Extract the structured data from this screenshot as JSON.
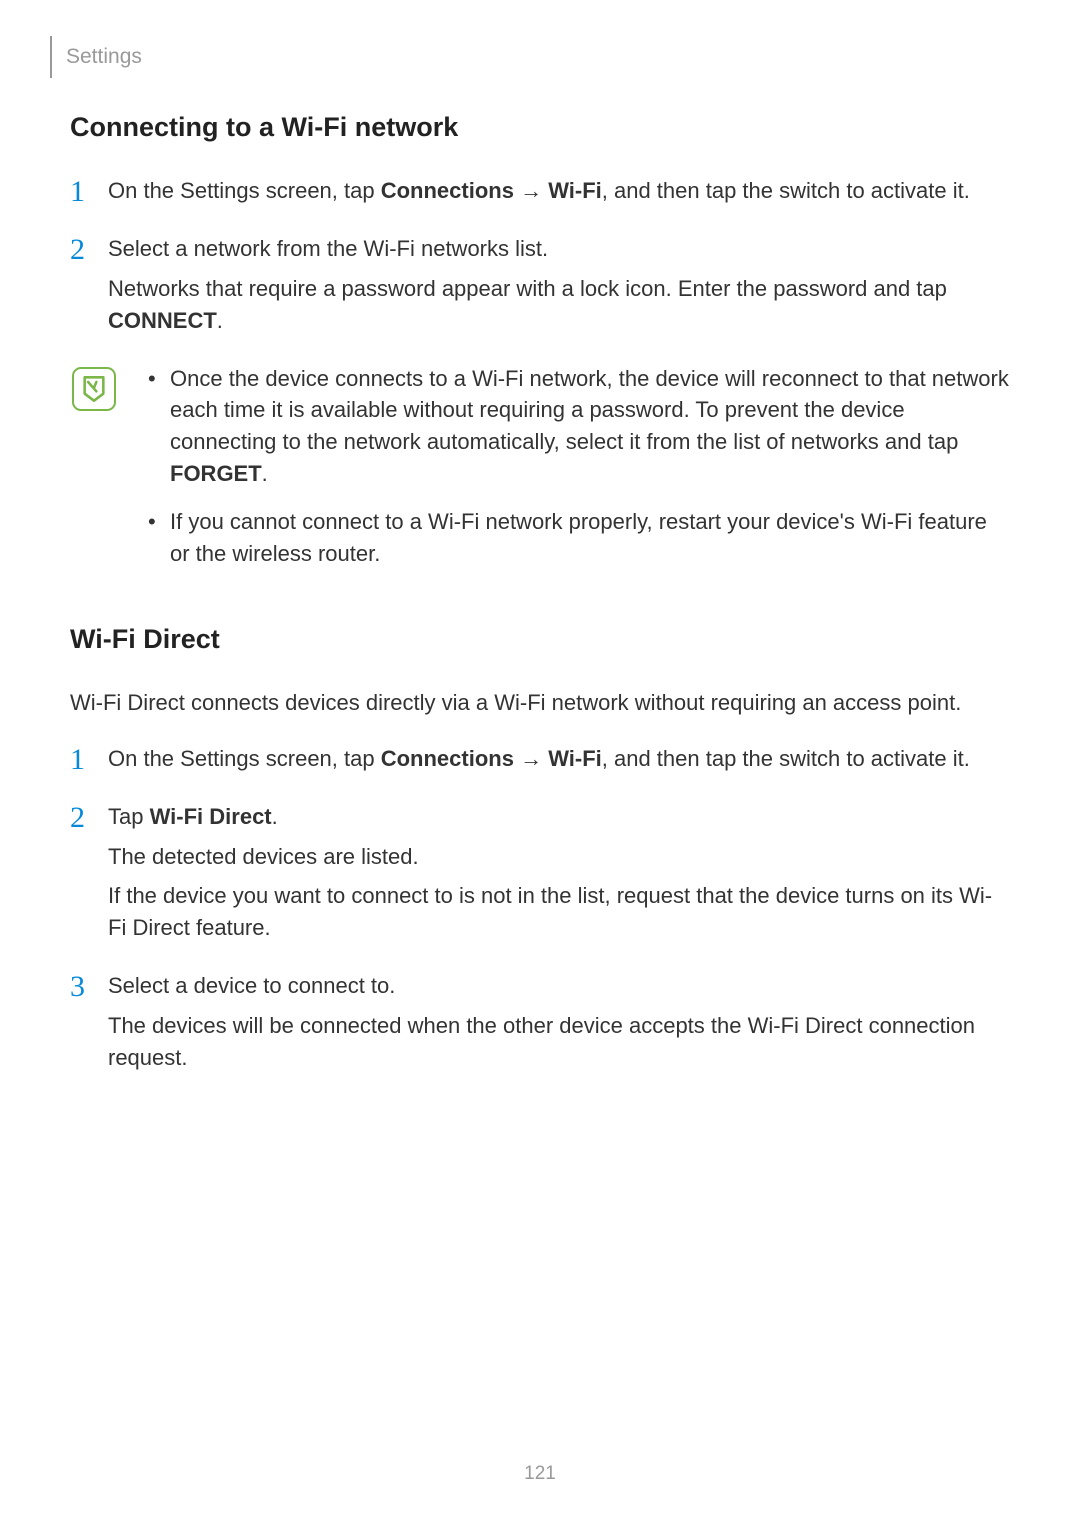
{
  "header": {
    "breadcrumb": "Settings"
  },
  "section1": {
    "title": "Connecting to a Wi-Fi network",
    "step1": {
      "num": "1",
      "pre": "On the Settings screen, tap ",
      "bold1": "Connections",
      "arrow": " → ",
      "bold2": "Wi-Fi",
      "post": ", and then tap the switch to activate it."
    },
    "step2": {
      "num": "2",
      "line1": "Select a network from the Wi-Fi networks list.",
      "line2pre": "Networks that require a password appear with a lock icon. Enter the password and tap ",
      "line2bold": "CONNECT",
      "line2post": "."
    },
    "note": {
      "bullet1pre": "Once the device connects to a Wi-Fi network, the device will reconnect to that network each time it is available without requiring a password. To prevent the device connecting to the network automatically, select it from the list of networks and tap ",
      "bullet1bold": "FORGET",
      "bullet1post": ".",
      "bullet2": "If you cannot connect to a Wi-Fi network properly, restart your device's Wi-Fi feature or the wireless router."
    }
  },
  "section2": {
    "title": "Wi-Fi Direct",
    "intro": "Wi-Fi Direct connects devices directly via a Wi-Fi network without requiring an access point.",
    "step1": {
      "num": "1",
      "pre": "On the Settings screen, tap ",
      "bold1": "Connections",
      "arrow": " → ",
      "bold2": "Wi-Fi",
      "post": ", and then tap the switch to activate it."
    },
    "step2": {
      "num": "2",
      "line1pre": "Tap ",
      "line1bold": "Wi-Fi Direct",
      "line1post": ".",
      "line2": "The detected devices are listed.",
      "line3": "If the device you want to connect to is not in the list, request that the device turns on its Wi-Fi Direct feature."
    },
    "step3": {
      "num": "3",
      "line1": "Select a device to connect to.",
      "line2": "The devices will be connected when the other device accepts the Wi-Fi Direct connection request."
    }
  },
  "pageNumber": "121"
}
